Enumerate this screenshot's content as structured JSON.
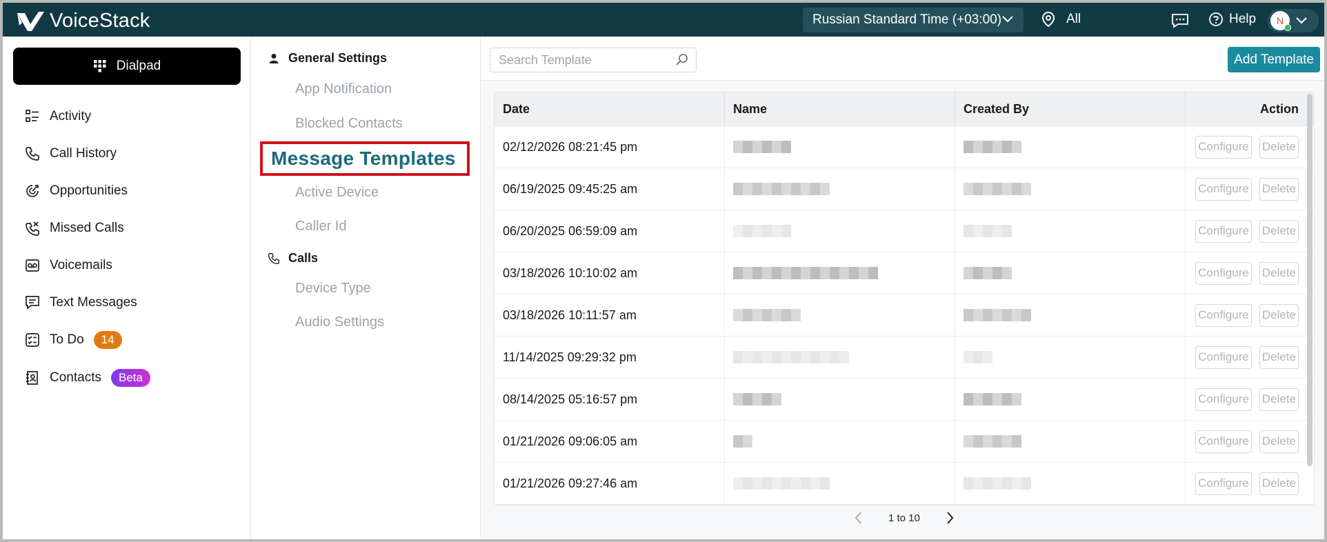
{
  "header": {
    "app_name": "VoiceStack",
    "timezone": "Russian Standard Time (+03:00)",
    "location": "All",
    "help_label": "Help",
    "avatar_initial": "N",
    "bg_color": "#123a45"
  },
  "sidebar": {
    "dialpad_label": "Dialpad",
    "items": [
      {
        "label": "Activity",
        "icon": "activity-icon"
      },
      {
        "label": "Call History",
        "icon": "phone-icon"
      },
      {
        "label": "Opportunities",
        "icon": "opportunities-icon"
      },
      {
        "label": "Missed Calls",
        "icon": "missed-call-icon"
      },
      {
        "label": "Voicemails",
        "icon": "voicemail-icon"
      },
      {
        "label": "Text Messages",
        "icon": "message-icon"
      },
      {
        "label": "To Do",
        "icon": "todo-icon",
        "badge": "14"
      },
      {
        "label": "Contacts",
        "icon": "contacts-icon",
        "badge": "Beta"
      }
    ]
  },
  "settings": {
    "general_heading": "General Settings",
    "general_items": [
      "App Notification",
      "Blocked Contacts",
      "Message Templates",
      "Active Device",
      "Caller Id"
    ],
    "active_item": "Message Templates",
    "calls_heading": "Calls",
    "calls_items": [
      "Device Type",
      "Audio Settings"
    ]
  },
  "main": {
    "search_placeholder": "Search Template",
    "add_button": "Add Template",
    "columns": [
      "Date",
      "Name",
      "Created By",
      "Action"
    ],
    "configure_label": "Configure",
    "delete_label": "Delete",
    "rows": [
      {
        "date": "02/12/2026 08:21:45 pm"
      },
      {
        "date": "06/19/2025 09:45:25 am"
      },
      {
        "date": "06/20/2025 06:59:09 am"
      },
      {
        "date": "03/18/2026 10:10:02 am"
      },
      {
        "date": "03/18/2026 10:11:57 am"
      },
      {
        "date": "11/14/2025 09:29:32 pm"
      },
      {
        "date": "08/14/2025 05:16:57 pm"
      },
      {
        "date": "01/21/2026 09:06:05 am"
      },
      {
        "date": "01/21/2026 09:27:46 am"
      }
    ],
    "pagination": "1 to 10"
  }
}
